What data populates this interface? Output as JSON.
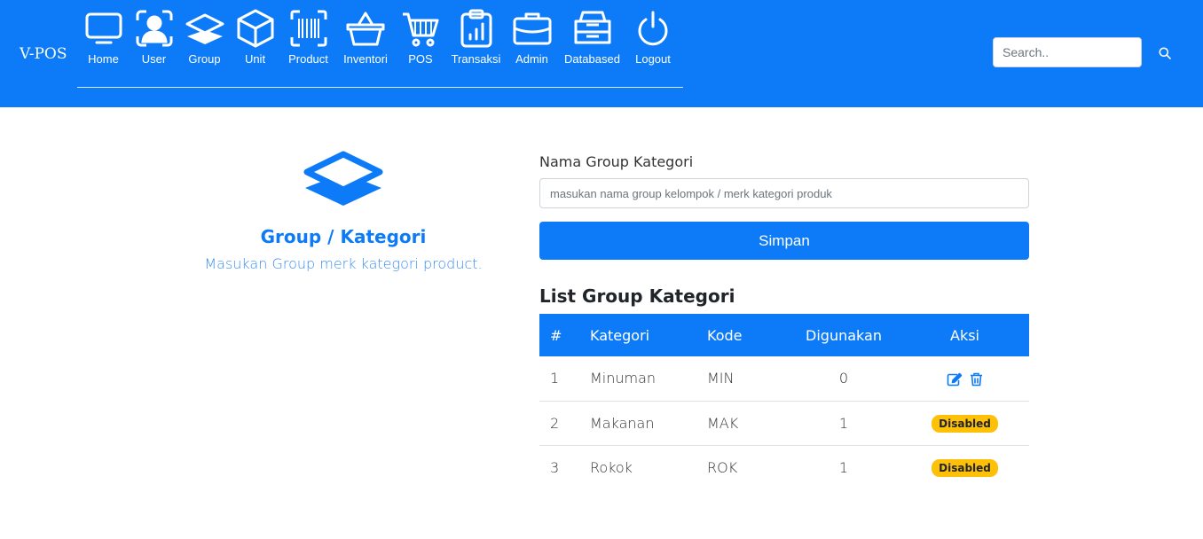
{
  "brand": "V-POS",
  "nav": [
    {
      "label": "Home",
      "icon": "monitor-icon"
    },
    {
      "label": "User",
      "icon": "user-icon"
    },
    {
      "label": "Group",
      "icon": "layers-icon"
    },
    {
      "label": "Unit",
      "icon": "box-icon"
    },
    {
      "label": "Product",
      "icon": "barcode-icon"
    },
    {
      "label": "Inventori",
      "icon": "basket-icon"
    },
    {
      "label": "POS",
      "icon": "cart-icon"
    },
    {
      "label": "Transaksi",
      "icon": "clipboard-chart-icon"
    },
    {
      "label": "Admin",
      "icon": "briefcase-icon"
    },
    {
      "label": "Databased",
      "icon": "inbox-icon"
    },
    {
      "label": "Logout",
      "icon": "power-icon"
    }
  ],
  "search": {
    "placeholder": "Search.."
  },
  "hero": {
    "icon": "layers-icon",
    "title": "Group / Kategori",
    "subtitle": "Masukan Group merk kategori product."
  },
  "form": {
    "label": "Nama Group Kategori",
    "placeholder": "masukan nama group kelompok / merk kategori produk",
    "value": "",
    "submit_label": "Simpan"
  },
  "list": {
    "title": "List Group Kategori",
    "columns": [
      "#",
      "Kategori",
      "Kode",
      "Digunakan",
      "Aksi"
    ],
    "rows": [
      {
        "no": "1",
        "kategori": "Minuman",
        "kode": "MIN",
        "digunakan": "0",
        "aksi": "icons"
      },
      {
        "no": "2",
        "kategori": "Makanan",
        "kode": "MAK",
        "digunakan": "1",
        "aksi": "Disabled"
      },
      {
        "no": "3",
        "kategori": "Rokok",
        "kode": "ROK",
        "digunakan": "1",
        "aksi": "Disabled"
      }
    ]
  },
  "colors": {
    "primary": "#0d7bf7",
    "badge": "#ffc107"
  }
}
